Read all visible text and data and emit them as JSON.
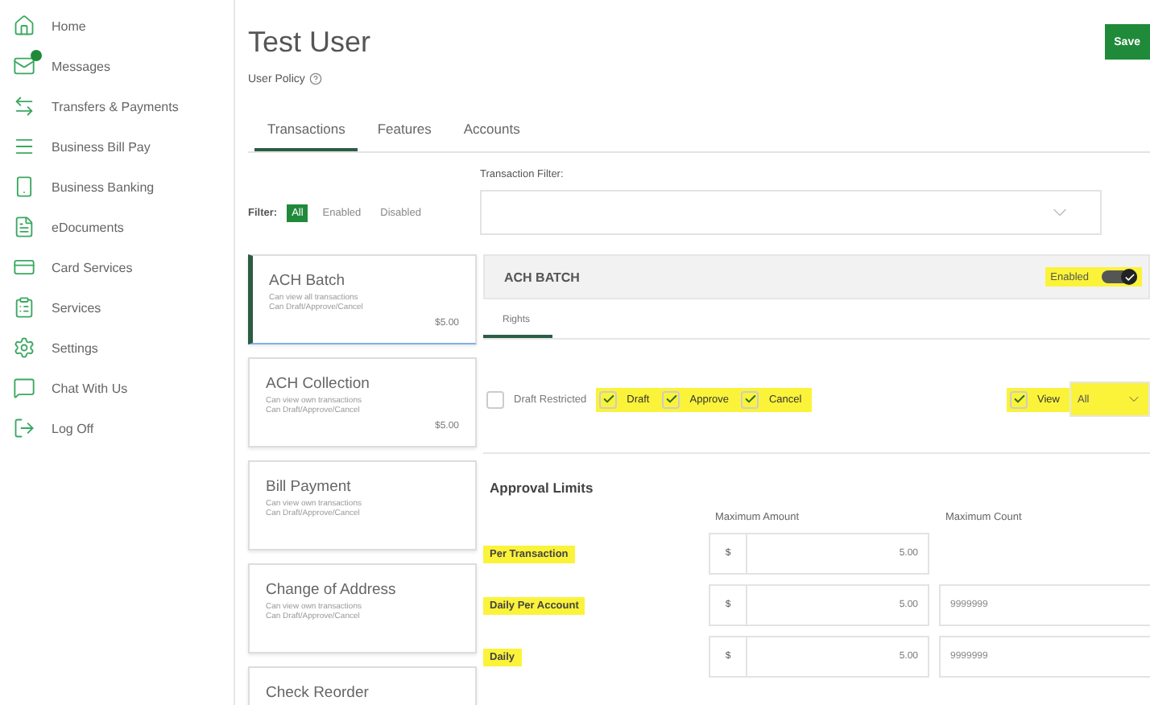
{
  "sidebar": {
    "items": [
      {
        "label": "Home",
        "badge": false
      },
      {
        "label": "Messages",
        "badge": true
      },
      {
        "label": "Transfers & Payments",
        "badge": false
      },
      {
        "label": "Business Bill Pay",
        "badge": false
      },
      {
        "label": "Business Banking",
        "badge": false
      },
      {
        "label": "eDocuments",
        "badge": false
      },
      {
        "label": "Card Services",
        "badge": false
      },
      {
        "label": "Services",
        "badge": false
      },
      {
        "label": "Settings",
        "badge": false
      },
      {
        "label": "Chat With Us",
        "badge": false
      },
      {
        "label": "Log Off",
        "badge": false
      }
    ]
  },
  "header": {
    "title": "Test User",
    "subtitle": "User Policy",
    "save": "Save"
  },
  "tabs": [
    {
      "label": "Transactions",
      "selected": true
    },
    {
      "label": "Features",
      "selected": false
    },
    {
      "label": "Accounts",
      "selected": false
    }
  ],
  "filter": {
    "label": "Filter:",
    "options": [
      {
        "label": "All",
        "selected": true
      },
      {
        "label": "Enabled",
        "selected": false
      },
      {
        "label": "Disabled",
        "selected": false
      }
    ]
  },
  "transaction_filter": {
    "label": "Transaction Filter:"
  },
  "transactions": [
    {
      "name": "ACH Batch",
      "lines": [
        "Can view all transactions",
        "Can Draft/Approve/Cancel"
      ],
      "amount": "$5.00",
      "selected": true
    },
    {
      "name": "ACH Collection",
      "lines": [
        "Can view own transactions",
        "Can Draft/Approve/Cancel"
      ],
      "amount": "$5.00",
      "selected": false
    },
    {
      "name": "Bill Payment",
      "lines": [
        "Can view own transactions",
        "Can Draft/Approve/Cancel"
      ],
      "selected": false
    },
    {
      "name": "Change of Address",
      "lines": [
        "Can view own transactions",
        "Can Draft/Approve/Cancel"
      ],
      "selected": false
    },
    {
      "name": "Check Reorder",
      "selected": false
    }
  ],
  "detail": {
    "title": "ACH BATCH",
    "status": "Enabled",
    "enabled": true,
    "highlighted": true,
    "subtabs": [
      {
        "label": "Rights",
        "selected": true
      }
    ],
    "rights": [
      {
        "label": "Draft Restricted",
        "checked": false,
        "highlighted": false
      },
      {
        "label": "Draft",
        "checked": true,
        "highlighted": true
      },
      {
        "label": "Approve",
        "checked": true,
        "highlighted": true
      },
      {
        "label": "Cancel",
        "checked": true,
        "highlighted": true
      }
    ],
    "view": {
      "label": "View",
      "checked": true,
      "value": "All",
      "highlighted": true
    },
    "limits_title": "Approval Limits",
    "columns": [
      "Maximum Amount",
      "Maximum Count"
    ],
    "limits": [
      {
        "label": "Per Transaction",
        "currency": "$",
        "amount": "5.00",
        "highlighted": true
      },
      {
        "label": "Daily Per Account",
        "currency": "$",
        "amount": "5.00",
        "count": "9999999",
        "highlighted": true
      },
      {
        "label": "Daily",
        "currency": "$",
        "amount": "5.00",
        "count": "9999999",
        "highlighted": true
      }
    ]
  }
}
